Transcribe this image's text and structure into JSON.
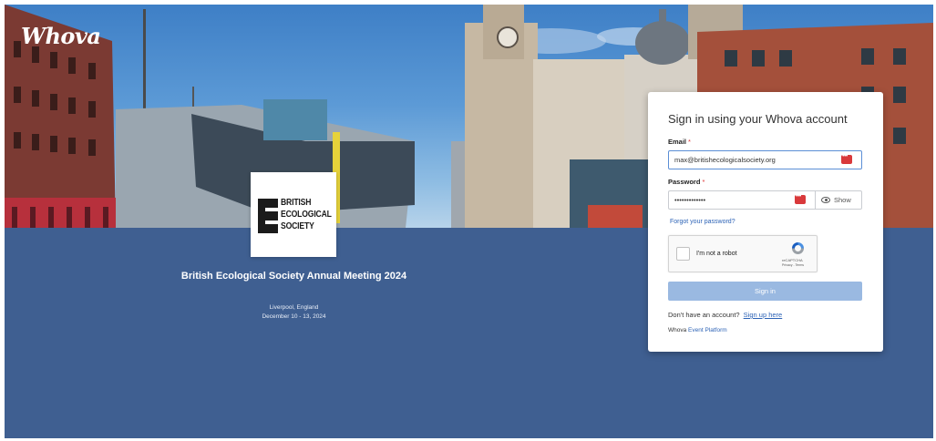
{
  "brand": {
    "logo_text": "Whova"
  },
  "event": {
    "org_logo_lines": [
      "BRITISH",
      "ECOLOGICAL",
      "SOCIETY"
    ],
    "title": "British Ecological Society Annual Meeting 2024",
    "location": "Liverpool, England",
    "dates": "December 10 - 13, 2024"
  },
  "signin": {
    "title": "Sign in using your Whova account",
    "email_label": "Email",
    "email_value": "max@britishecologicalsociety.org",
    "password_label": "Password",
    "password_value": "•••••••••••••",
    "required_marker": "*",
    "show_label": "Show",
    "forgot_password": "Forgot your password?",
    "captcha_label": "I'm not a robot",
    "captcha_brand": "reCAPTCHA",
    "captcha_links": "Privacy - Terms",
    "signin_button": "Sign in",
    "no_account_text": "Don't have an account?",
    "signup_link": "Sign up here",
    "footer_prefix": "Whova",
    "footer_link": "Event Platform"
  },
  "colors": {
    "banner_bg": "#3f5f91",
    "signin_button": "#9ab9e1",
    "link": "#2d63b6",
    "required": "#dd3333"
  },
  "icons": [
    "whova-logo",
    "bes-logo",
    "password-manager-icon",
    "eye-icon",
    "recaptcha-icon"
  ]
}
